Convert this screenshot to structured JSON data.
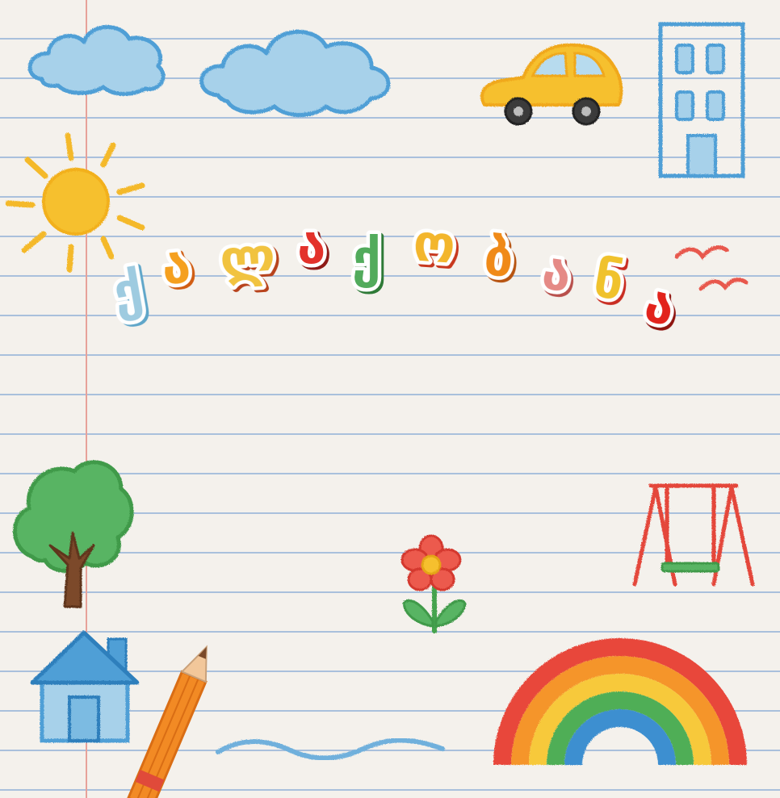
{
  "title": {
    "text": "ქალაქობანა",
    "letters": [
      {
        "char": "ქ",
        "color": "#9ecbe0",
        "shadow": "#5fa6c9"
      },
      {
        "char": "ა",
        "color": "#f5a01f",
        "shadow": "#d15d12"
      },
      {
        "char": "ლ",
        "color": "#f1c340",
        "shadow": "#b8431c"
      },
      {
        "char": "ა",
        "color": "#e3322b",
        "shadow": "#8e1b17"
      },
      {
        "char": "ქ",
        "color": "#52ab5c",
        "shadow": "#2e7a37"
      },
      {
        "char": "ო",
        "color": "#f3b62d",
        "shadow": "#c8381e"
      },
      {
        "char": "ბ",
        "color": "#f08a18",
        "shadow": "#b75411"
      },
      {
        "char": "ა",
        "color": "#e58a86",
        "shadow": "#b8504c"
      },
      {
        "char": "ნ",
        "color": "#f0c22c",
        "shadow": "#c92d22"
      },
      {
        "char": "ა",
        "color": "#e2231c",
        "shadow": "#8e140f"
      }
    ]
  },
  "icons": {
    "cloud": "cloud-icon",
    "sun": "sun-icon",
    "car": "car-icon",
    "building": "building-icon",
    "birds": "birds-icon",
    "tree": "tree-icon",
    "flower": "flower-icon",
    "swing": "swing-icon",
    "house": "house-icon",
    "pencil": "pencil-icon",
    "wave": "wave-icon",
    "rainbow": "rainbow-icon"
  },
  "colors": {
    "paper": "#f4f1ec",
    "ruled_line": "#a9c0dc",
    "margin_line": "#e7a29a",
    "crayon_blue": "#4f9fd6",
    "crayon_yellow": "#f6c02e",
    "crayon_green": "#44a34e",
    "crayon_red": "#e4473b",
    "crayon_orange": "#f08a24"
  }
}
